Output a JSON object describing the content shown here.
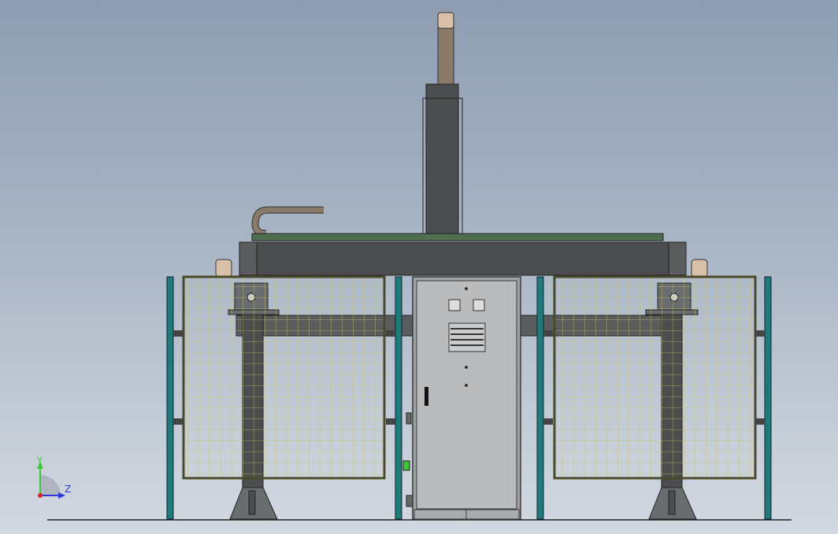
{
  "view": {
    "background_top": "#8e9db2",
    "background_bottom": "#d3d9e1"
  },
  "triad": {
    "y_label": "Y",
    "z_label": "Z",
    "y_color": "#3cc43c",
    "z_color": "#2a3bd6",
    "origin_color": "#d62a2a"
  },
  "colors": {
    "steel_dark": "#4b4d4f",
    "steel_mid": "#6a6d70",
    "post_teal": "#1f7a7a",
    "mesh_yellow": "#c8c860",
    "beam_green": "#4e6e4e",
    "cabinet": "#b9bbbd",
    "cabinet_edge": "#3a3b3c",
    "pad": "#d9c0a8",
    "arm_brown": "#8a7a6a"
  }
}
